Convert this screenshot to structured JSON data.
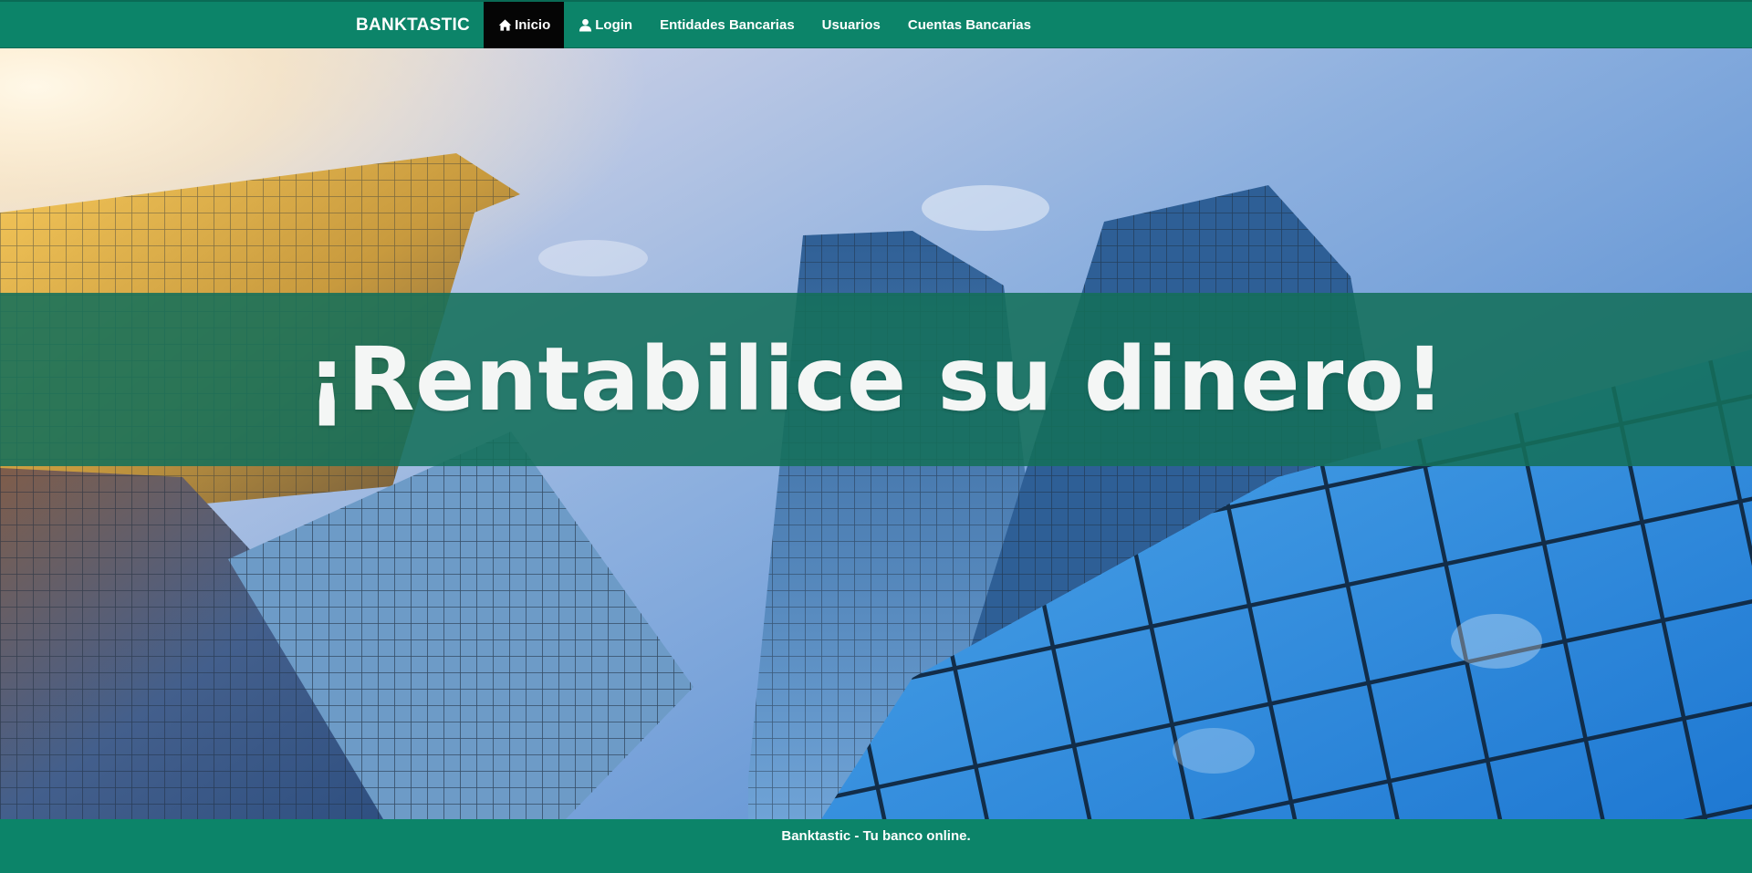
{
  "nav": {
    "brand": "BANKTASTIC",
    "items": [
      {
        "label": "Inicio",
        "icon": "home-icon",
        "active": true
      },
      {
        "label": "Login",
        "icon": "user-icon",
        "active": false
      },
      {
        "label": "Entidades Bancarias"
      },
      {
        "label": "Usuarios"
      },
      {
        "label": "Cuentas Bancarias"
      }
    ]
  },
  "hero": {
    "title": "¡Rentabilice su dinero!",
    "image": "glass-skyscrapers-background"
  },
  "footer": {
    "text": "Banktastic - Tu banco online."
  },
  "colors": {
    "primary": "#0c8469",
    "active_nav": "#050505",
    "banner_overlay": "#14705a"
  }
}
